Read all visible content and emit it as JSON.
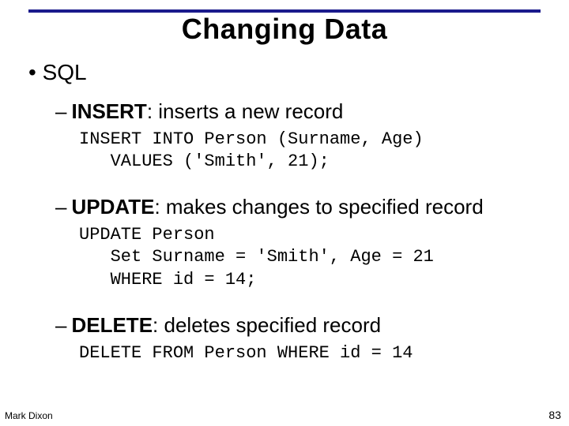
{
  "slide": {
    "title": "Changing Data",
    "bullet_lvl1": "• SQL",
    "items": [
      {
        "dash": "–",
        "keyword": "INSERT",
        "rest": ": inserts a new record",
        "code": "INSERT INTO Person (Surname, Age)\n   VALUES ('Smith', 21);"
      },
      {
        "dash": "–",
        "keyword": "UPDATE",
        "rest": ": makes changes to specified record",
        "code": "UPDATE Person\n   Set Surname = 'Smith', Age = 21\n   WHERE id = 14;"
      },
      {
        "dash": "–",
        "keyword": "DELETE",
        "rest": ": deletes specified record",
        "code": "DELETE FROM Person WHERE id = 14"
      }
    ],
    "footer_author": "Mark Dixon",
    "footer_page": "83"
  }
}
